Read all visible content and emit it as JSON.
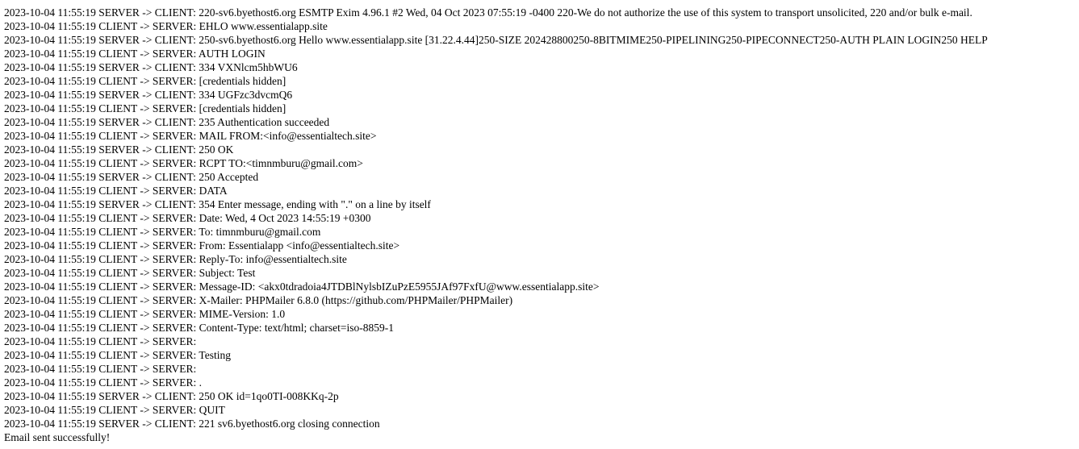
{
  "log": {
    "lines": [
      "2023-10-04 11:55:19 SERVER -> CLIENT: 220-sv6.byethost6.org ESMTP Exim 4.96.1 #2 Wed, 04 Oct 2023 07:55:19 -0400 220-We do not authorize the use of this system to transport unsolicited, 220 and/or bulk e-mail.",
      "2023-10-04 11:55:19 CLIENT -> SERVER: EHLO www.essentialapp.site",
      "2023-10-04 11:55:19 SERVER -> CLIENT: 250-sv6.byethost6.org Hello www.essentialapp.site [31.22.4.44]250-SIZE 202428800250-8BITMIME250-PIPELINING250-PIPECONNECT250-AUTH PLAIN LOGIN250 HELP",
      "2023-10-04 11:55:19 CLIENT -> SERVER: AUTH LOGIN",
      "2023-10-04 11:55:19 SERVER -> CLIENT: 334 VXNlcm5hbWU6",
      "2023-10-04 11:55:19 CLIENT -> SERVER: [credentials hidden]",
      "2023-10-04 11:55:19 SERVER -> CLIENT: 334 UGFzc3dvcmQ6",
      "2023-10-04 11:55:19 CLIENT -> SERVER: [credentials hidden]",
      "2023-10-04 11:55:19 SERVER -> CLIENT: 235 Authentication succeeded",
      "2023-10-04 11:55:19 CLIENT -> SERVER: MAIL FROM:<info@essentialtech.site>",
      "2023-10-04 11:55:19 SERVER -> CLIENT: 250 OK",
      "2023-10-04 11:55:19 CLIENT -> SERVER: RCPT TO:<timnmburu@gmail.com>",
      "2023-10-04 11:55:19 SERVER -> CLIENT: 250 Accepted",
      "2023-10-04 11:55:19 CLIENT -> SERVER: DATA",
      "2023-10-04 11:55:19 SERVER -> CLIENT: 354 Enter message, ending with \".\" on a line by itself",
      "2023-10-04 11:55:19 CLIENT -> SERVER: Date: Wed, 4 Oct 2023 14:55:19 +0300",
      "2023-10-04 11:55:19 CLIENT -> SERVER: To: timnmburu@gmail.com",
      "2023-10-04 11:55:19 CLIENT -> SERVER: From: Essentialapp <info@essentialtech.site>",
      "2023-10-04 11:55:19 CLIENT -> SERVER: Reply-To: info@essentialtech.site",
      "2023-10-04 11:55:19 CLIENT -> SERVER: Subject: Test",
      "2023-10-04 11:55:19 CLIENT -> SERVER: Message-ID: <akx0tdradoia4JTDBlNylsbIZuPzE5955JAf97FxfU@www.essentialapp.site>",
      "2023-10-04 11:55:19 CLIENT -> SERVER: X-Mailer: PHPMailer 6.8.0 (https://github.com/PHPMailer/PHPMailer)",
      "2023-10-04 11:55:19 CLIENT -> SERVER: MIME-Version: 1.0",
      "2023-10-04 11:55:19 CLIENT -> SERVER: Content-Type: text/html; charset=iso-8859-1",
      "2023-10-04 11:55:19 CLIENT -> SERVER:",
      "2023-10-04 11:55:19 CLIENT -> SERVER: Testing",
      "2023-10-04 11:55:19 CLIENT -> SERVER:",
      "2023-10-04 11:55:19 CLIENT -> SERVER: .",
      "2023-10-04 11:55:19 SERVER -> CLIENT: 250 OK id=1qo0TI-008KKq-2p",
      "2023-10-04 11:55:19 CLIENT -> SERVER: QUIT",
      "2023-10-04 11:55:19 SERVER -> CLIENT: 221 sv6.byethost6.org closing connection"
    ],
    "status_message": "Email sent successfully!"
  }
}
